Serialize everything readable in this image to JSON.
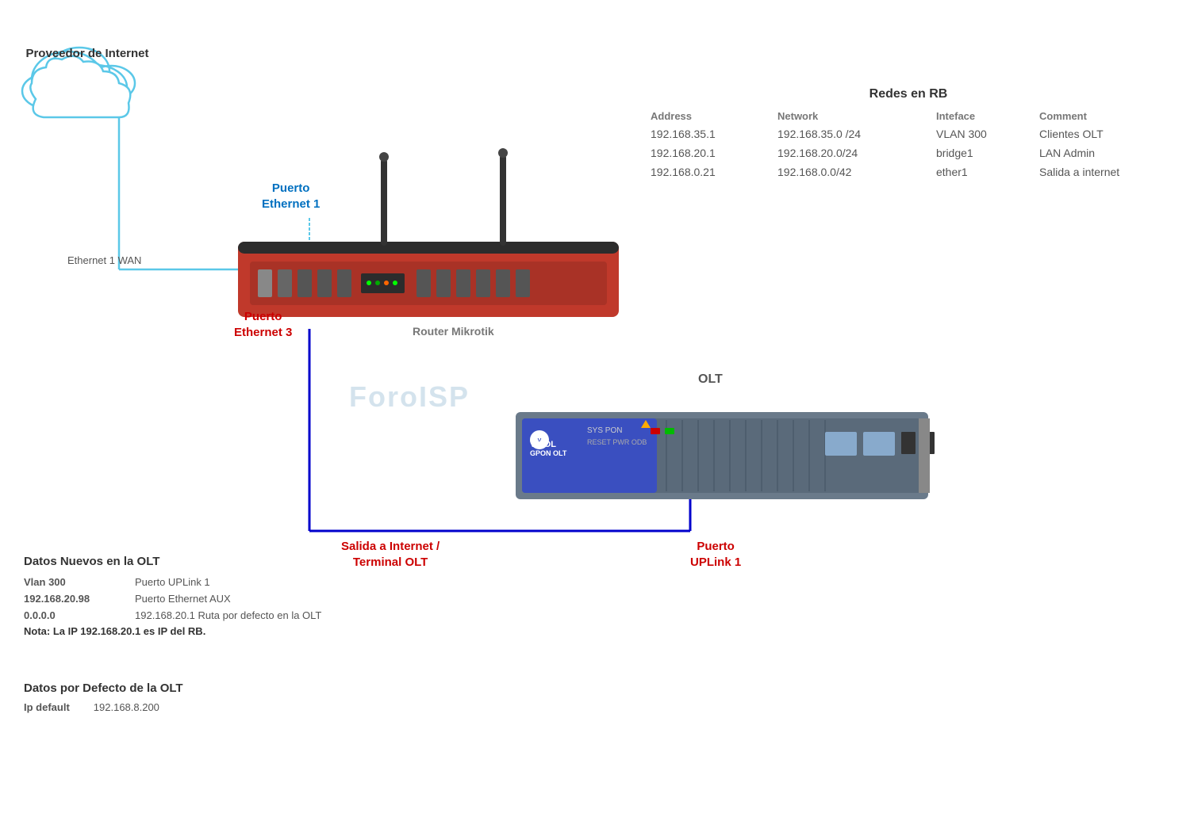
{
  "cloud": {
    "label": "Proveedor de\nInternet"
  },
  "redes": {
    "title": "Redes en RB",
    "headers": {
      "address": "Address",
      "network": "Network",
      "interface": "Inteface",
      "comment": "Comment"
    },
    "rows": [
      {
        "address": "192.168.35.1",
        "network": "192.168.35.0 /24",
        "interface": "VLAN 300",
        "comment": "Clientes OLT"
      },
      {
        "address": "192.168.20.1",
        "network": "192.168.20.0/24",
        "interface": "bridge1",
        "comment": "LAN Admin"
      },
      {
        "address": "192.168.0.21",
        "network": "192.168.0.0/42",
        "interface": "ether1",
        "comment": "Salida a internet"
      }
    ]
  },
  "labels": {
    "puerto_ethernet1": "Puerto\nEthernet 1",
    "ethernet1_wan": "Ethernet 1\nWAN",
    "puerto_ethernet3": "Puerto\nEthernet 3",
    "router_mikrotik": "Router Mikrotik",
    "olt": "OLT",
    "salida_internet": "Salida a Internet /\nTerminal  OLT",
    "puerto_uplink1": "Puerto\nUPLink 1"
  },
  "olt_device": {
    "brand": "V-SOL",
    "model": "GPON OLT"
  },
  "watermark": {
    "text": "ForoISP"
  },
  "datos_nuevos": {
    "title": "Datos Nuevos en  la OLT",
    "rows": [
      {
        "col1": "Vlan 300",
        "col2": "Puerto UPLink 1"
      },
      {
        "col1": "192.168.20.98",
        "col2": "Puerto Ethernet AUX"
      },
      {
        "col1": "0.0.0.0",
        "col2": "192.168.20.1    Ruta  por defecto en la OLT"
      },
      {
        "col1": "Nota:",
        "col2": "La IP 192.168.20.1 es IP del RB."
      }
    ]
  },
  "datos_defecto": {
    "title": "Datos por Defecto de la OLT",
    "rows": [
      {
        "col1": "Ip default",
        "col2": "192.168.8.200"
      }
    ]
  }
}
